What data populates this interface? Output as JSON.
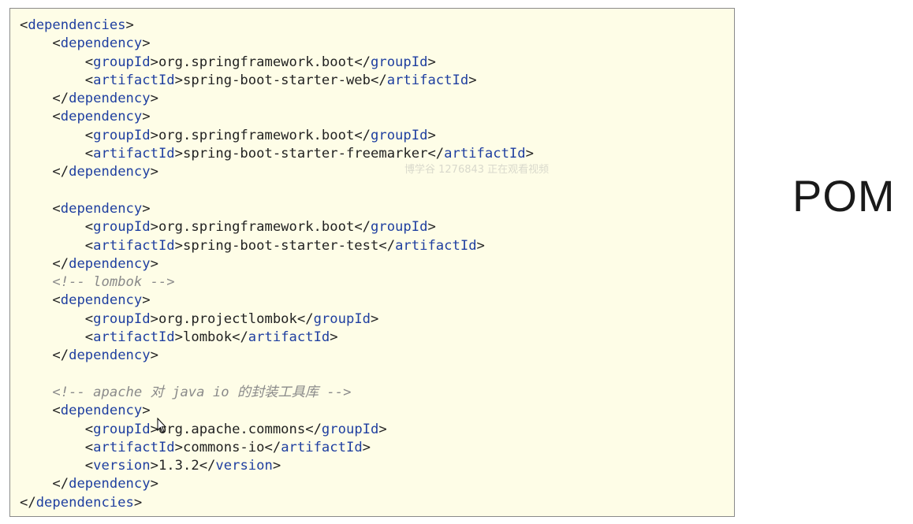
{
  "slide_title": "POM",
  "watermark": "博学谷 1276843 正在观看视频",
  "code_lines": [
    {
      "indent": 0,
      "kind": "open",
      "tag": "dependencies"
    },
    {
      "indent": 1,
      "kind": "open",
      "tag": "dependency"
    },
    {
      "indent": 2,
      "kind": "elem",
      "tag": "groupId",
      "text": "org.springframework.boot"
    },
    {
      "indent": 2,
      "kind": "elem",
      "tag": "artifactId",
      "text": "spring-boot-starter-web"
    },
    {
      "indent": 1,
      "kind": "close",
      "tag": "dependency"
    },
    {
      "indent": 1,
      "kind": "open",
      "tag": "dependency"
    },
    {
      "indent": 2,
      "kind": "elem",
      "tag": "groupId",
      "text": "org.springframework.boot"
    },
    {
      "indent": 2,
      "kind": "elem",
      "tag": "artifactId",
      "text": "spring-boot-starter-freemarker"
    },
    {
      "indent": 1,
      "kind": "close",
      "tag": "dependency"
    },
    {
      "indent": 0,
      "kind": "blank"
    },
    {
      "indent": 1,
      "kind": "open",
      "tag": "dependency"
    },
    {
      "indent": 2,
      "kind": "elem",
      "tag": "groupId",
      "text": "org.springframework.boot"
    },
    {
      "indent": 2,
      "kind": "elem",
      "tag": "artifactId",
      "text": "spring-boot-starter-test"
    },
    {
      "indent": 1,
      "kind": "close",
      "tag": "dependency"
    },
    {
      "indent": 1,
      "kind": "comment",
      "text": "<!-- lombok -->"
    },
    {
      "indent": 1,
      "kind": "open",
      "tag": "dependency"
    },
    {
      "indent": 2,
      "kind": "elem",
      "tag": "groupId",
      "text": "org.projectlombok"
    },
    {
      "indent": 2,
      "kind": "elem",
      "tag": "artifactId",
      "text": "lombok"
    },
    {
      "indent": 1,
      "kind": "close",
      "tag": "dependency"
    },
    {
      "indent": 0,
      "kind": "blank"
    },
    {
      "indent": 1,
      "kind": "comment",
      "text": "<!-- apache 对 java io 的封装工具库 -->"
    },
    {
      "indent": 1,
      "kind": "open",
      "tag": "dependency"
    },
    {
      "indent": 2,
      "kind": "elem",
      "tag": "groupId",
      "text": "org.apache.commons"
    },
    {
      "indent": 2,
      "kind": "elem",
      "tag": "artifactId",
      "text": "commons-io"
    },
    {
      "indent": 2,
      "kind": "elem",
      "tag": "version",
      "text": "1.3.2"
    },
    {
      "indent": 1,
      "kind": "close",
      "tag": "dependency"
    },
    {
      "indent": 0,
      "kind": "close",
      "tag": "dependencies"
    }
  ]
}
